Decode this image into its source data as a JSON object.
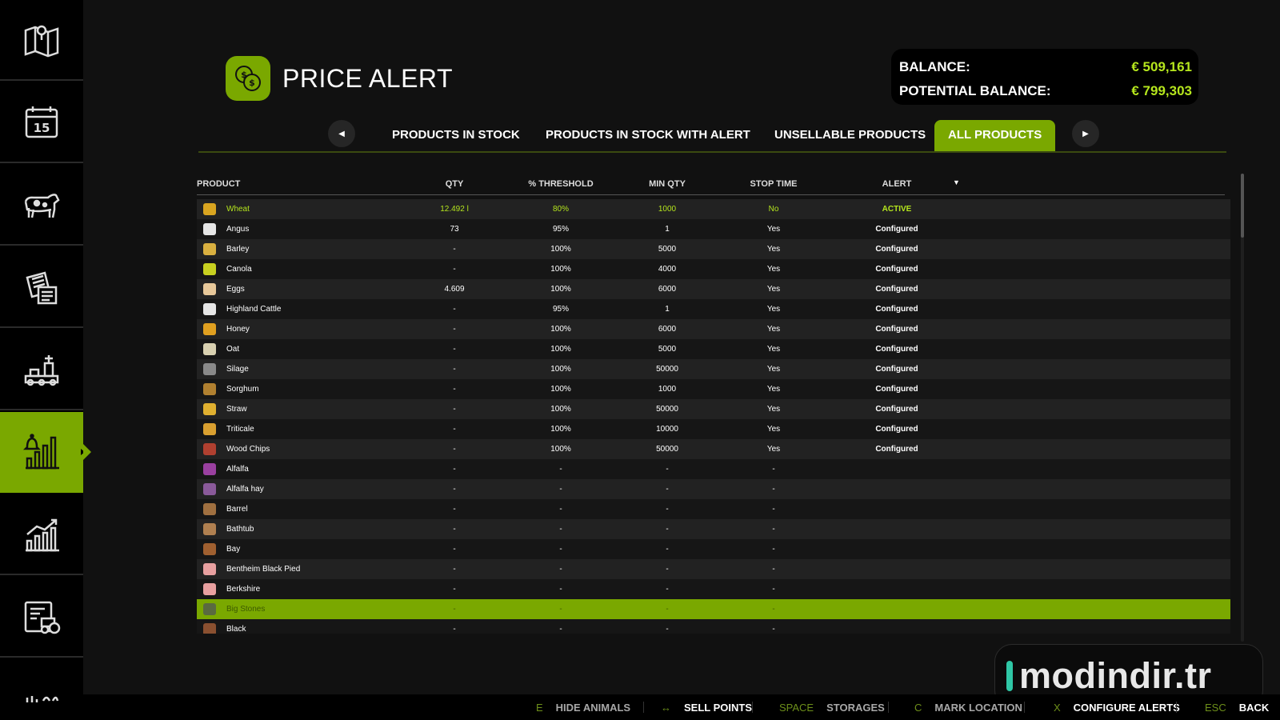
{
  "header": {
    "title": "PRICE ALERT"
  },
  "balance": {
    "balance_label": "BALANCE:",
    "balance_value": "€ 509,161",
    "potential_label": "POTENTIAL BALANCE:",
    "potential_value": "€ 799,303"
  },
  "tabs": [
    {
      "label": "PRODUCTS IN STOCK",
      "active": false
    },
    {
      "label": "PRODUCTS IN STOCK WITH ALERT",
      "active": false
    },
    {
      "label": "UNSELLABLE PRODUCTS",
      "active": false
    },
    {
      "label": "ALL PRODUCTS",
      "active": true
    }
  ],
  "table": {
    "columns": {
      "product": "PRODUCT",
      "qty": "QTY",
      "threshold": "% THRESHOLD",
      "min_qty": "MIN QTY",
      "stop_time": "STOP TIME",
      "alert": "ALERT"
    },
    "rows": [
      {
        "name": "Wheat",
        "qty": "12.492 l",
        "threshold": "80%",
        "min_qty": "1000",
        "stop": "No",
        "alert": "ACTIVE",
        "icon": "wheat-icon",
        "icon_color": "#d9a520"
      },
      {
        "name": "Angus",
        "qty": "73",
        "threshold": "95%",
        "min_qty": "1",
        "stop": "Yes",
        "alert": "Configured",
        "icon": "cow-icon",
        "icon_color": "#e6e6e6"
      },
      {
        "name": "Barley",
        "qty": "-",
        "threshold": "100%",
        "min_qty": "5000",
        "stop": "Yes",
        "alert": "Configured",
        "icon": "barley-icon",
        "icon_color": "#d9b040"
      },
      {
        "name": "Canola",
        "qty": "-",
        "threshold": "100%",
        "min_qty": "4000",
        "stop": "Yes",
        "alert": "Configured",
        "icon": "canola-icon",
        "icon_color": "#c8d020"
      },
      {
        "name": "Eggs",
        "qty": "4.609",
        "threshold": "100%",
        "min_qty": "6000",
        "stop": "Yes",
        "alert": "Configured",
        "icon": "egg-icon",
        "icon_color": "#e8c89a"
      },
      {
        "name": "Highland Cattle",
        "qty": "-",
        "threshold": "95%",
        "min_qty": "1",
        "stop": "Yes",
        "alert": "Configured",
        "icon": "cow-icon",
        "icon_color": "#e6e6e6"
      },
      {
        "name": "Honey",
        "qty": "-",
        "threshold": "100%",
        "min_qty": "6000",
        "stop": "Yes",
        "alert": "Configured",
        "icon": "honey-icon",
        "icon_color": "#e0a020"
      },
      {
        "name": "Oat",
        "qty": "-",
        "threshold": "100%",
        "min_qty": "5000",
        "stop": "Yes",
        "alert": "Configured",
        "icon": "oat-icon",
        "icon_color": "#d8d0b0"
      },
      {
        "name": "Silage",
        "qty": "-",
        "threshold": "100%",
        "min_qty": "50000",
        "stop": "Yes",
        "alert": "Configured",
        "icon": "silage-icon",
        "icon_color": "#8a8a8a"
      },
      {
        "name": "Sorghum",
        "qty": "-",
        "threshold": "100%",
        "min_qty": "1000",
        "stop": "Yes",
        "alert": "Configured",
        "icon": "sorghum-icon",
        "icon_color": "#b08030"
      },
      {
        "name": "Straw",
        "qty": "-",
        "threshold": "100%",
        "min_qty": "50000",
        "stop": "Yes",
        "alert": "Configured",
        "icon": "straw-icon",
        "icon_color": "#e0b030"
      },
      {
        "name": "Triticale",
        "qty": "-",
        "threshold": "100%",
        "min_qty": "10000",
        "stop": "Yes",
        "alert": "Configured",
        "icon": "triticale-icon",
        "icon_color": "#d9a030"
      },
      {
        "name": "Wood Chips",
        "qty": "-",
        "threshold": "100%",
        "min_qty": "50000",
        "stop": "Yes",
        "alert": "Configured",
        "icon": "woodchips-icon",
        "icon_color": "#b04030"
      },
      {
        "name": "Alfalfa",
        "qty": "-",
        "threshold": "-",
        "min_qty": "-",
        "stop": "-",
        "alert": "",
        "icon": "alfalfa-icon",
        "icon_color": "#9a40a0"
      },
      {
        "name": "Alfalfa hay",
        "qty": "-",
        "threshold": "-",
        "min_qty": "-",
        "stop": "-",
        "alert": "",
        "icon": "hay-icon",
        "icon_color": "#8a5a9a"
      },
      {
        "name": "Barrel",
        "qty": "-",
        "threshold": "-",
        "min_qty": "-",
        "stop": "-",
        "alert": "",
        "icon": "barrel-icon",
        "icon_color": "#a07040"
      },
      {
        "name": "Bathtub",
        "qty": "-",
        "threshold": "-",
        "min_qty": "-",
        "stop": "-",
        "alert": "",
        "icon": "bathtub-icon",
        "icon_color": "#b08050"
      },
      {
        "name": "Bay",
        "qty": "-",
        "threshold": "-",
        "min_qty": "-",
        "stop": "-",
        "alert": "",
        "icon": "horse-icon",
        "icon_color": "#a06030"
      },
      {
        "name": "Bentheim Black Pied",
        "qty": "-",
        "threshold": "-",
        "min_qty": "-",
        "stop": "-",
        "alert": "",
        "icon": "pig-icon",
        "icon_color": "#e8a0a0"
      },
      {
        "name": "Berkshire",
        "qty": "-",
        "threshold": "-",
        "min_qty": "-",
        "stop": "-",
        "alert": "",
        "icon": "pig-icon",
        "icon_color": "#e8a0a0"
      },
      {
        "name": "Big Stones",
        "qty": "-",
        "threshold": "-",
        "min_qty": "-",
        "stop": "-",
        "alert": "",
        "icon": "stone-icon",
        "icon_color": "#5a6a40",
        "highlighted": true
      },
      {
        "name": "Black",
        "qty": "-",
        "threshold": "-",
        "min_qty": "-",
        "stop": "-",
        "alert": "",
        "icon": "horse-icon",
        "icon_color": "#8a5030"
      }
    ]
  },
  "watermark": {
    "text": "modindir.tr"
  },
  "hints": [
    {
      "key": "E",
      "label": "HIDE ANIMALS",
      "bright": false
    },
    {
      "key": "↔",
      "label": "SELL POINTS",
      "bright": true
    },
    {
      "key": "SPACE",
      "label": "STORAGES",
      "bright": false
    },
    {
      "key": "C",
      "label": "MARK LOCATION",
      "bright": false
    },
    {
      "key": "X",
      "label": "CONFIGURE ALERTS",
      "bright": true
    },
    {
      "key": "ESC",
      "label": "BACK",
      "bright": true
    }
  ],
  "sidebar": {
    "items": [
      {
        "icon": "map-icon"
      },
      {
        "icon": "calendar-icon",
        "text": "15"
      },
      {
        "icon": "animals-icon"
      },
      {
        "icon": "contracts-icon"
      },
      {
        "icon": "production-icon"
      },
      {
        "icon": "price-alert-icon",
        "active": true
      },
      {
        "icon": "statistics-icon"
      },
      {
        "icon": "vehicles-icon"
      },
      {
        "icon": "more-icon"
      }
    ]
  },
  "colors": {
    "accent": "#7aa800",
    "value_green": "#b5e61d",
    "background": "#111111"
  }
}
